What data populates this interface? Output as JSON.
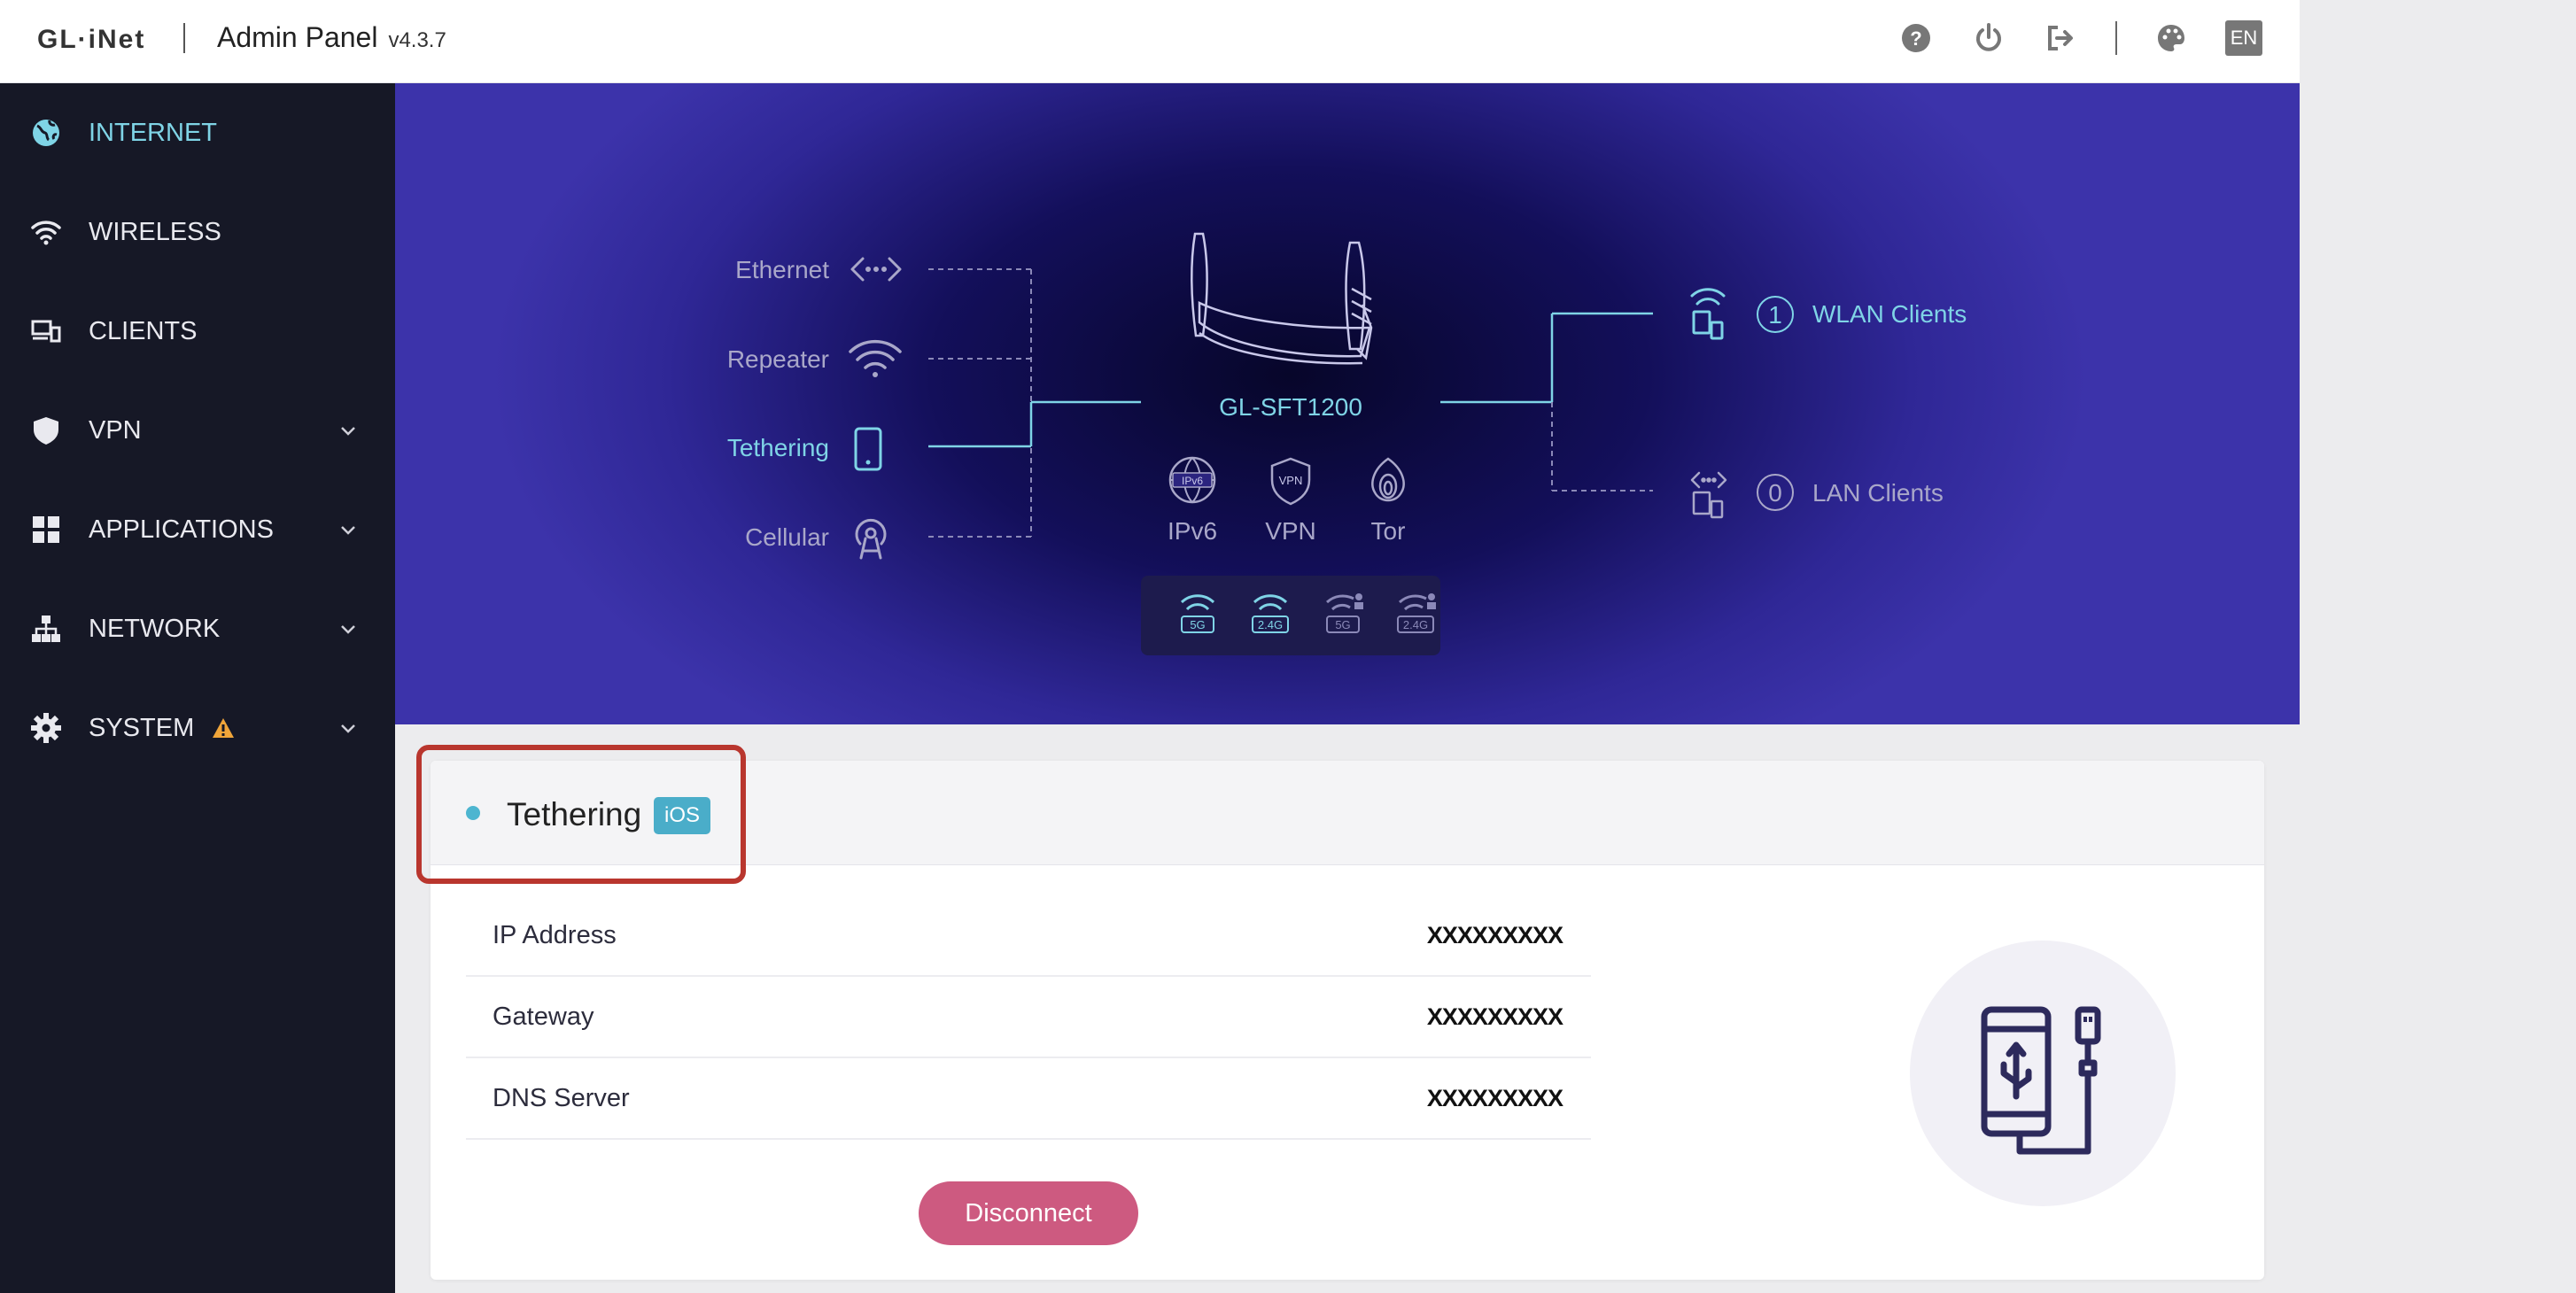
{
  "header": {
    "logo": "GL·iNet",
    "title": "Admin Panel",
    "version": "v4.3.7",
    "icons": [
      "help-icon",
      "power-icon",
      "logout-icon",
      "theme-icon"
    ],
    "language": "EN"
  },
  "sidebar": {
    "items": [
      {
        "label": "INTERNET",
        "icon": "globe-icon",
        "active": true,
        "expandable": false
      },
      {
        "label": "WIRELESS",
        "icon": "wifi-icon",
        "active": false,
        "expandable": false
      },
      {
        "label": "CLIENTS",
        "icon": "devices-icon",
        "active": false,
        "expandable": false
      },
      {
        "label": "VPN",
        "icon": "shield-icon",
        "active": false,
        "expandable": true
      },
      {
        "label": "APPLICATIONS",
        "icon": "grid-icon",
        "active": false,
        "expandable": true
      },
      {
        "label": "NETWORK",
        "icon": "network-icon",
        "active": false,
        "expandable": true
      },
      {
        "label": "SYSTEM",
        "icon": "gear-icon",
        "active": false,
        "expandable": true,
        "warning": true
      }
    ]
  },
  "topology": {
    "sources": [
      {
        "label": "Ethernet",
        "icon": "ethernet-icon",
        "active": false
      },
      {
        "label": "Repeater",
        "icon": "wifi-icon",
        "active": false
      },
      {
        "label": "Tethering",
        "icon": "phone-icon",
        "active": true
      },
      {
        "label": "Cellular",
        "icon": "cellular-icon",
        "active": false
      }
    ],
    "router_name": "GL-SFT1200",
    "features": [
      {
        "label": "IPv6",
        "icon_text": "IPv6"
      },
      {
        "label": "VPN",
        "icon_text": "VPN"
      },
      {
        "label": "Tor",
        "icon_text": ""
      }
    ],
    "wifi_bands": [
      "5G",
      "2.4G",
      "5G",
      "2.4G"
    ],
    "clients": [
      {
        "count": "1",
        "label": "WLAN Clients",
        "active": true
      },
      {
        "count": "0",
        "label": "LAN Clients",
        "active": false
      }
    ]
  },
  "tethering": {
    "title": "Tethering",
    "badge": "iOS",
    "rows": [
      {
        "label": "IP Address",
        "value": "XXXXXXXXX"
      },
      {
        "label": "Gateway",
        "value": "XXXXXXXXX"
      },
      {
        "label": "DNS Server",
        "value": "XXXXXXXXX"
      }
    ],
    "disconnect_label": "Disconnect"
  },
  "colors": {
    "accent": "#7fd4e6",
    "sidebar_bg": "#161826",
    "hero_bg": "#2f2796",
    "badge": "#4aadc9",
    "disconnect": "#cd5a80",
    "highlight": "#b9362e"
  }
}
